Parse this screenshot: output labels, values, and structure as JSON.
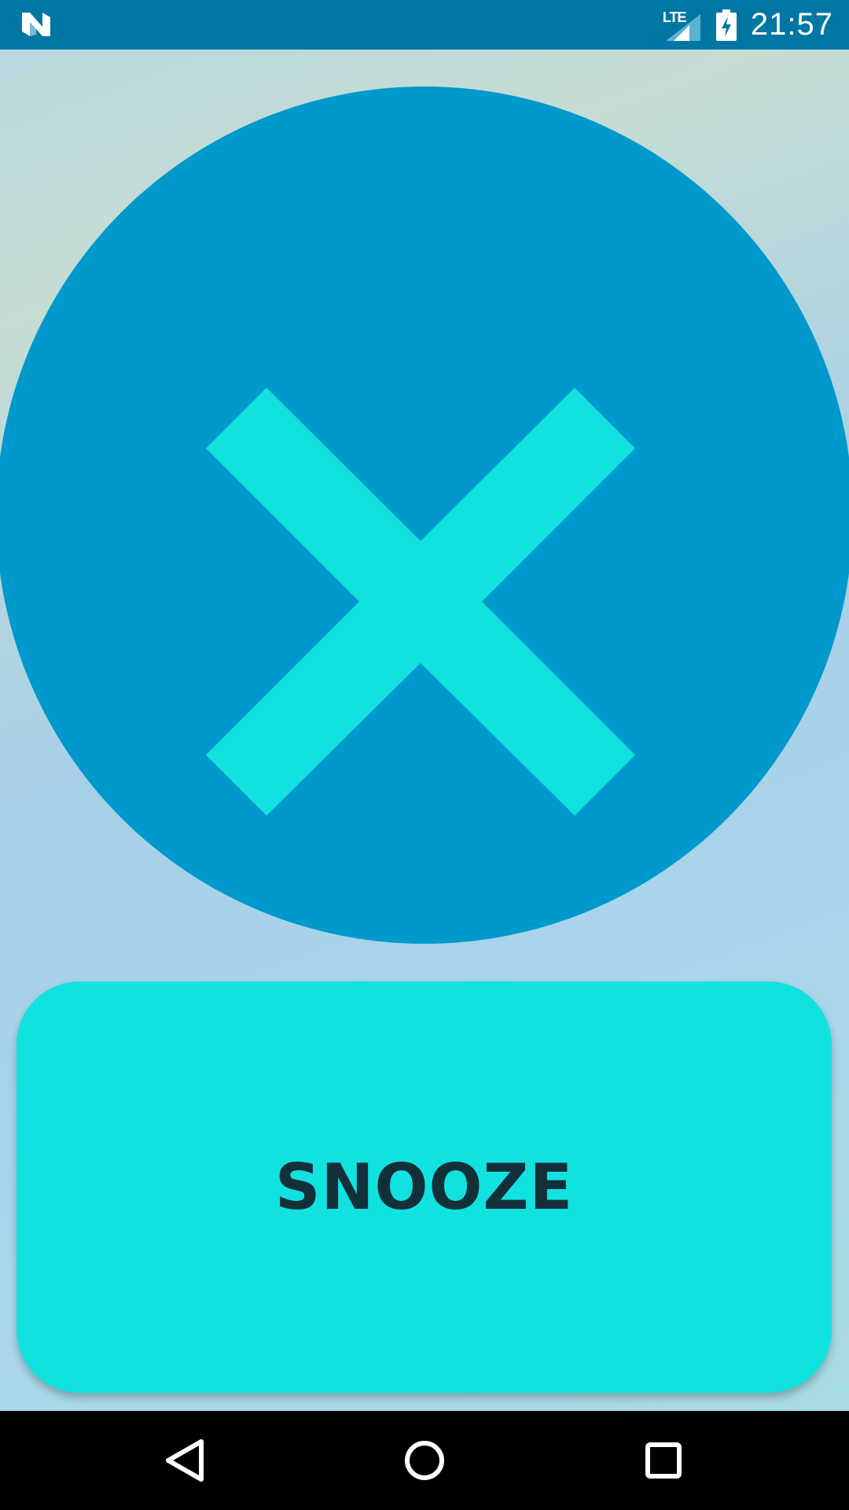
{
  "status_bar": {
    "logo_icon": "android-n-icon",
    "network_label": "LTE",
    "signal_icon": "cell-signal-icon",
    "battery_icon": "battery-charging-icon",
    "time": "21:57",
    "background_color": "#0077a3"
  },
  "alarm": {
    "dismiss_icon": "close-icon",
    "dismiss_color": "#0099cc",
    "icon_color": "#11e2e0",
    "snooze_label": "SNOOZE",
    "snooze_color": "#11e2e0"
  },
  "nav_bar": {
    "back_icon": "back-triangle-icon",
    "home_icon": "home-circle-icon",
    "recents_icon": "recents-square-icon"
  }
}
